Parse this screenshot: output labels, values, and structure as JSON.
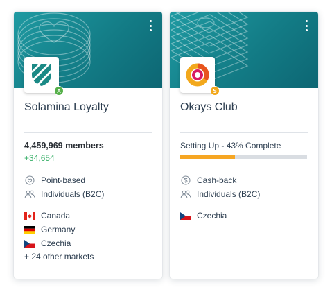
{
  "cards": [
    {
      "title": "Solamina Loyalty",
      "badge": "A",
      "badge_color": "#56b04a",
      "members": "4,459,969 members",
      "delta": "+34,654",
      "delta_color": "#3ab16a",
      "program_type": "Point-based",
      "audience": "Individuals (B2C)",
      "markets": [
        "Canada",
        "Germany",
        "Czechia"
      ],
      "more_markets": "+ 24 other markets"
    },
    {
      "title": "Okays Club",
      "badge": "S",
      "badge_color": "#f2a81c",
      "status": "Setting Up - 43% Complete",
      "progress": 0.43,
      "progress_color": "#f6a623",
      "program_type": "Cash-back",
      "audience": "Individuals (B2C)",
      "markets": [
        "Czechia"
      ]
    }
  ],
  "icons": {
    "menu": "kebab-menu-icon",
    "program_type_card1": "heart-badge-icon",
    "program_type_card2": "dollar-badge-icon",
    "audience": "people-icon"
  },
  "colors": {
    "banner": "#137c86",
    "card1_logo": "#1b8a86",
    "card2_logo_ring": "#f2a81c",
    "card2_logo_center": "#d81b60"
  }
}
